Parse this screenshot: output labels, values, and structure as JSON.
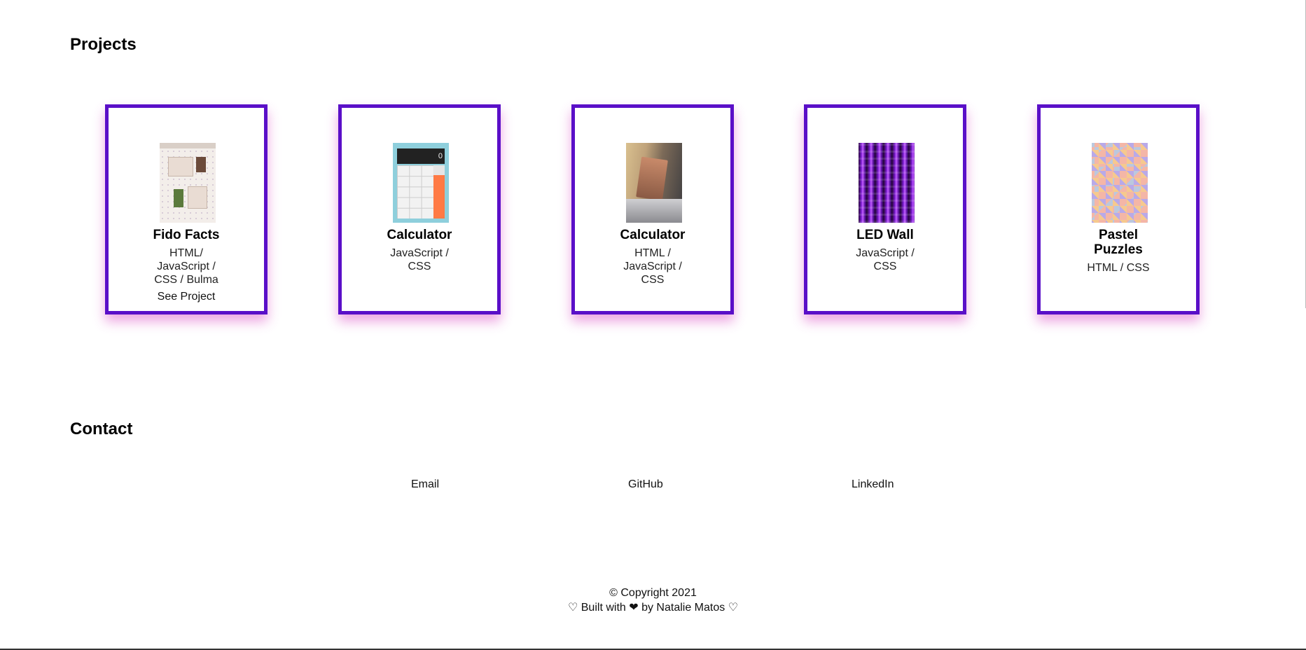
{
  "sections": {
    "projects_title": "Projects",
    "contact_title": "Contact"
  },
  "projects": [
    {
      "title": "Fido Facts",
      "tech": "HTML/ JavaScript / CSS / Bulma",
      "link": "See Project",
      "thumbnail": "fido-facts-screenshot"
    },
    {
      "title": "Calculator",
      "tech": "JavaScript / CSS",
      "thumbnail": "calculator-app-screenshot"
    },
    {
      "title": "Calculator",
      "tech": "HTML / JavaScript / CSS",
      "thumbnail": "calculator-photo"
    },
    {
      "title": "LED Wall",
      "tech": "JavaScript / CSS",
      "thumbnail": "led-wall-image"
    },
    {
      "title": "Pastel Puzzles",
      "tech": "HTML / CSS",
      "thumbnail": "pastel-pattern-image"
    }
  ],
  "calculator_display": "0",
  "contact": {
    "email": "Email",
    "github": "GitHub",
    "linkedin": "LinkedIn"
  },
  "footer": {
    "copyright": "© Copyright 2021",
    "credit": "♡ Built with ❤ by Natalie Matos ♡"
  },
  "colors": {
    "card_border": "#5a0fc8",
    "card_glow": "#d63cbe"
  }
}
